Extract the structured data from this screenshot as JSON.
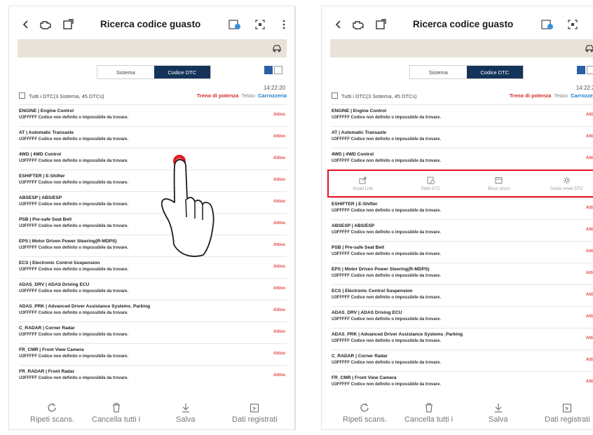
{
  "app": {
    "title": "Ricerca codice guasto",
    "segments": [
      "Sistema",
      "Codice DTC"
    ],
    "active_segment": 1,
    "timestamp": "14:22:20",
    "summary": "Tutti i DTC(3 Sistema, 45 DTCs)",
    "filters": {
      "red": "Treno di potenza",
      "grey": "Telaio",
      "blue": "Carrozzeria"
    },
    "status_label": "Attivo",
    "code_text": "U3FFFFF Codice non definito o impossibile da trovare."
  },
  "dtc_left": [
    "ENGINE | Engine Control",
    "AT | Automatic Transaxle",
    "4WD | 4WD Control",
    "ESHIFTER | E-Shifter",
    "ABSESP | ABS/ESP",
    "PSB | Pre-safe Seat Belt",
    "EPS | Motor Driven Power Steering(R-MDPS)",
    "ECS | Electronic Control Suspension",
    "ADAS_DRV | ADAS Driving ECU",
    "ADAS_PRK | Advanced Driver Assistance Systems_Parking",
    "C_RADAR | Corner Radar",
    "FR_CMR | Front View Camera",
    "FR_RADAR | Front Radar"
  ],
  "dtc_right_before": [
    "ENGINE | Engine Control",
    "AT | Automatic Transaxle",
    "4WD | 4WD Control"
  ],
  "dtc_right_after": [
    "ESHIFTER | E-Shifter",
    "ABSESP | ABS/ESP",
    "PSB | Pre-safe Seat Belt",
    "EPS | Motor Driven Power Steering(R-MDPS)",
    "ECS | Electronic Control Suspension",
    "ADAS_DRV | ADAS Driving ECU",
    "ADAS_PRK | Advanced Driver Assistance Systems_Parking",
    "C_RADAR | Corner Radar",
    "FR_CMR | Front View Camera"
  ],
  "action_bar": [
    "Smart Link",
    "Stato DTC",
    "Blocc struct",
    "Guida smart DTC"
  ],
  "bottom_bar": [
    "Ripeti scans.",
    "Cancella tutti i",
    "Salva",
    "Dati registrati"
  ],
  "colors": {
    "highlight": "#e8141e",
    "nav_active": "#14335a",
    "status_red": "#e04444",
    "vehicle_strip": "#e9e2d8"
  },
  "icons": [
    "back-icon",
    "engine-icon",
    "export-icon",
    "dtc-info-icon",
    "scan-icon",
    "more-icon",
    "car-icon",
    "grid-view-icon",
    "list-view-icon",
    "refresh-icon",
    "trash-icon",
    "download-icon",
    "folder-icon",
    "share-icon",
    "status-icon",
    "freeze-frame-icon",
    "gear-icon",
    "hand-pointer-icon"
  ]
}
